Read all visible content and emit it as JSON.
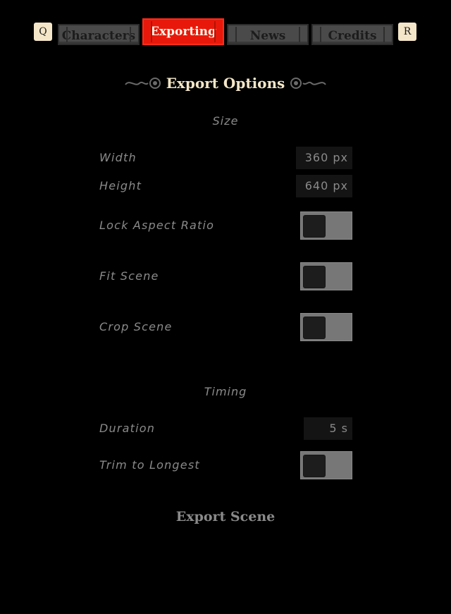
{
  "tabs": {
    "prev_key": "Q",
    "next_key": "R",
    "items": [
      {
        "label": "Characters"
      },
      {
        "label": "Exporting"
      },
      {
        "label": "News"
      },
      {
        "label": "Credits"
      }
    ],
    "active": "Exporting"
  },
  "panel": {
    "title": "Export Options",
    "size_section": "Size",
    "width_label": "Width",
    "width_value": "360 px",
    "height_label": "Height",
    "height_value": "640 px",
    "lock_label": "Lock Aspect Ratio",
    "lock_on": false,
    "fit_label": "Fit Scene",
    "fit_on": false,
    "crop_label": "Crop Scene",
    "crop_on": false,
    "timing_section": "Timing",
    "duration_label": "Duration",
    "duration_value": "5 s",
    "trim_label": "Trim to Longest",
    "trim_on": false,
    "export_button": "Export Scene"
  },
  "colors": {
    "background": "#000000",
    "active_tab": "#e8190b",
    "inactive_tab": "#4a4a4a",
    "title": "#f4e6c8",
    "muted_text": "#8a8a8a",
    "toggle_track": "#777777"
  }
}
